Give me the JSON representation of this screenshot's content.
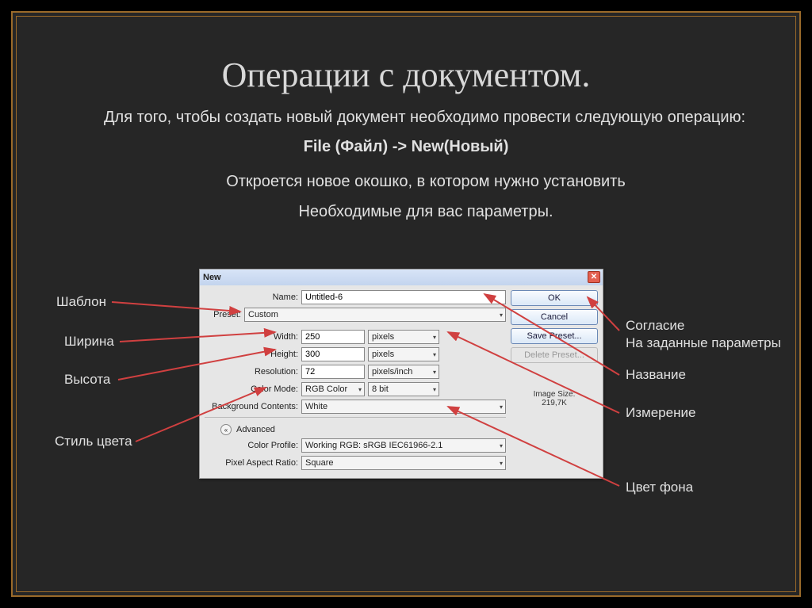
{
  "slide": {
    "title": "Операции с документом.",
    "intro": "Для того, чтобы создать новый документ необходимо провести следующую операцию:",
    "menu_path": "File (Файл) -> New(Новый)",
    "desc1": "Откроется новое окошко, в котором нужно установить",
    "desc2": "Необходимые для вас параметры."
  },
  "dialog": {
    "title": "New",
    "name_label": "Name:",
    "name_value": "Untitled-6",
    "preset_label": "Preset:",
    "preset_value": "Custom",
    "width_label": "Width:",
    "width_value": "250",
    "width_unit": "pixels",
    "height_label": "Height:",
    "height_value": "300",
    "height_unit": "pixels",
    "res_label": "Resolution:",
    "res_value": "72",
    "res_unit": "pixels/inch",
    "cmode_label": "Color Mode:",
    "cmode_value": "RGB Color",
    "cmode_depth": "8 bit",
    "bg_label": "Background Contents:",
    "bg_value": "White",
    "advanced": "Advanced",
    "cprofile_label": "Color Profile:",
    "cprofile_value": "Working RGB: sRGB IEC61966-2.1",
    "par_label": "Pixel Aspect Ratio:",
    "par_value": "Square",
    "ok": "OK",
    "cancel": "Cancel",
    "save_preset": "Save Preset...",
    "delete_preset": "Delete Preset...",
    "image_size_label": "Image Size:",
    "image_size_value": "219,7K"
  },
  "callouts": {
    "template": "Шаблон",
    "width": "Ширина",
    "height": "Высота",
    "color_style": "Стиль цвета",
    "agree1": "Согласие",
    "agree2": "На заданные параметры",
    "name": "Название",
    "measure": "Измерение",
    "bgcolor": "Цвет фона"
  }
}
